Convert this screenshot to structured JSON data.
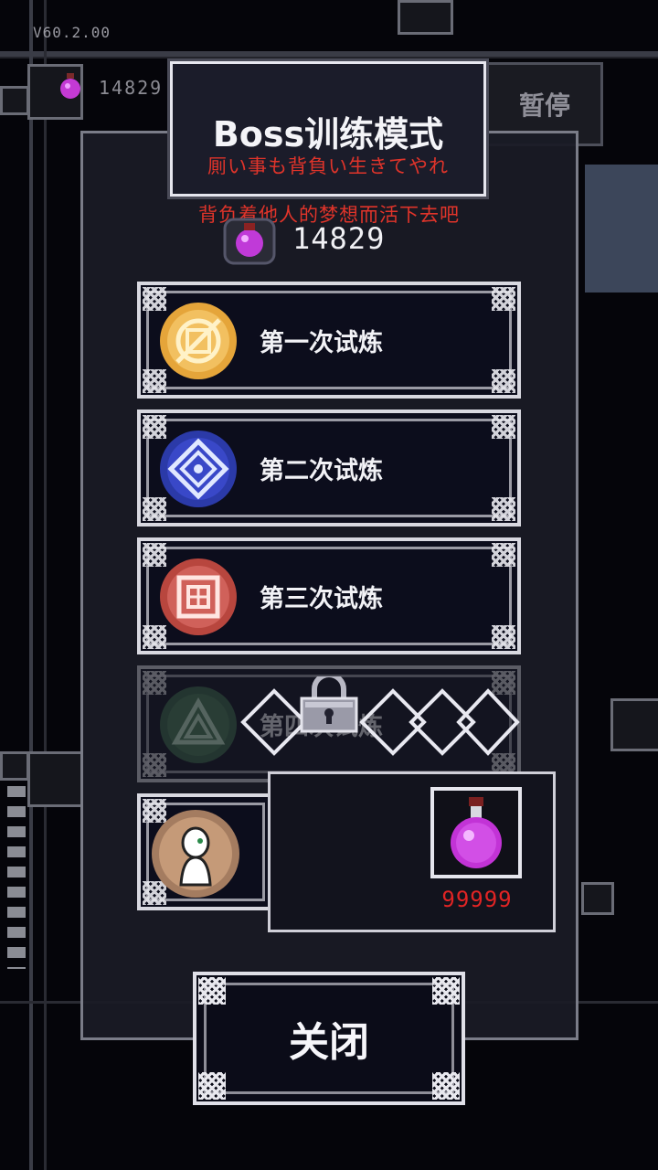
{
  "hud": {
    "version": "V60.2.00",
    "gem_count": "14829",
    "pause_label": "暂停"
  },
  "dialog": {
    "title": "Boss训练模式",
    "subtitle_jp": "厠い事も背負い生きてやれ",
    "subtitle_cn": "背负着他人的梦想而活下去吧",
    "gem_count": "14829",
    "trials": [
      {
        "label": "第一次试炼",
        "icon": "gold-seal-icon",
        "locked": false
      },
      {
        "label": "第二次试炼",
        "icon": "blue-seal-icon",
        "locked": false
      },
      {
        "label": "第三次试炼",
        "icon": "red-seal-icon",
        "locked": false
      },
      {
        "label": "第四次试炼",
        "icon": "green-seal-icon",
        "locked": true
      }
    ],
    "potion_count": "99999",
    "close_label": "关闭"
  },
  "colors": {
    "accent_red": "#e0342a",
    "panel_bg": "#1a1b26",
    "border_light": "#e6e6ee"
  }
}
